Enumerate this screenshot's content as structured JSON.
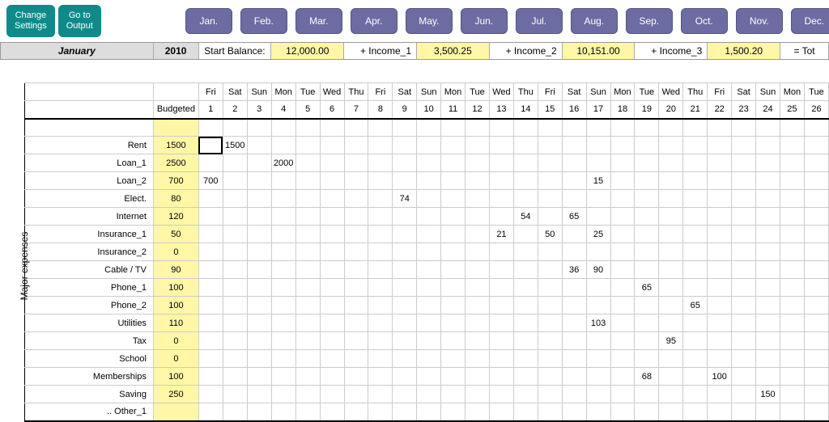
{
  "buttons": {
    "settings": "Change\nSettings",
    "output": "Go to\nOutput"
  },
  "months": [
    "Jan.",
    "Feb.",
    "Mar.",
    "Apr.",
    "May.",
    "Jun.",
    "Jul.",
    "Aug.",
    "Sep.",
    "Oct.",
    "Nov.",
    "Dec."
  ],
  "summary": {
    "month": "January",
    "year": "2010",
    "start_label": "Start Balance:",
    "start_value": "12,000.00",
    "income1_label": "+ Income_1",
    "income1_value": "3,500.25",
    "income2_label": "+ Income_2",
    "income2_value": "10,151.00",
    "income3_label": "+ Income_3",
    "income3_value": "1,500.20",
    "total_label": "= Tot"
  },
  "side_label": "Major expenses",
  "budget_header": "Budgeted",
  "dow": [
    "Fri",
    "Sat",
    "Sun",
    "Mon",
    "Tue",
    "Wed",
    "Thu",
    "Fri",
    "Sat",
    "Sun",
    "Mon",
    "Tue",
    "Wed",
    "Thu",
    "Fri",
    "Sat",
    "Sun",
    "Mon",
    "Tue",
    "Wed",
    "Thu",
    "Fri",
    "Sat",
    "Sun",
    "Mon",
    "Tue"
  ],
  "daynum": [
    "1",
    "2",
    "3",
    "4",
    "5",
    "6",
    "7",
    "8",
    "9",
    "10",
    "11",
    "12",
    "13",
    "14",
    "15",
    "16",
    "17",
    "18",
    "19",
    "20",
    "21",
    "22",
    "23",
    "24",
    "25",
    "26"
  ],
  "rows": [
    {
      "label": "Rent",
      "budget": "1500",
      "cells": {
        "1": "1500"
      }
    },
    {
      "label": "Loan_1",
      "budget": "2500",
      "cells": {
        "3": "2000"
      }
    },
    {
      "label": "Loan_2",
      "budget": "700",
      "cells": {
        "0": "700",
        "16": "15"
      }
    },
    {
      "label": "Elect.",
      "budget": "80",
      "cells": {
        "8": "74"
      }
    },
    {
      "label": "Internet",
      "budget": "120",
      "cells": {
        "13": "54",
        "15": "65"
      }
    },
    {
      "label": "Insurance_1",
      "budget": "50",
      "cells": {
        "12": "21",
        "14": "50",
        "16": "25"
      }
    },
    {
      "label": "Insurance_2",
      "budget": "0",
      "cells": {}
    },
    {
      "label": "Cable / TV",
      "budget": "90",
      "cells": {
        "15": "36",
        "16": "90"
      }
    },
    {
      "label": "Phone_1",
      "budget": "100",
      "cells": {
        "18": "65"
      }
    },
    {
      "label": "Phone_2",
      "budget": "100",
      "cells": {
        "20": "65"
      }
    },
    {
      "label": "Utilities",
      "budget": "110",
      "cells": {
        "16": "103"
      }
    },
    {
      "label": "Tax",
      "budget": "0",
      "cells": {
        "19": "95"
      }
    },
    {
      "label": "School",
      "budget": "0",
      "cells": {}
    },
    {
      "label": "Memberships",
      "budget": "100",
      "cells": {
        "18": "68",
        "21": "100"
      }
    },
    {
      "label": "Saving",
      "budget": "250",
      "cells": {
        "23": "150"
      }
    },
    {
      "label": ".. Other_1",
      "budget": "",
      "cells": {}
    }
  ]
}
